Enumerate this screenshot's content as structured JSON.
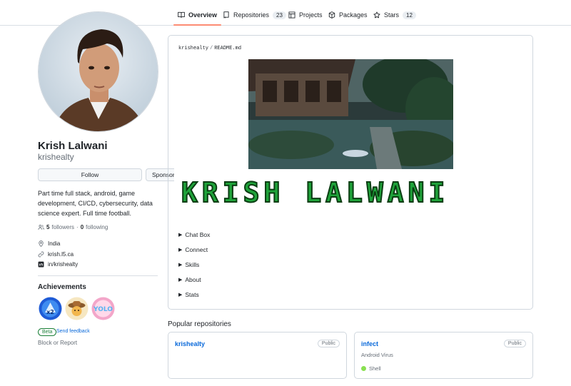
{
  "tabs": [
    {
      "label": "Overview",
      "icon": "book-icon",
      "active": true
    },
    {
      "label": "Repositories",
      "icon": "repo-icon",
      "count": "23"
    },
    {
      "label": "Projects",
      "icon": "table-icon"
    },
    {
      "label": "Packages",
      "icon": "package-icon"
    },
    {
      "label": "Stars",
      "icon": "star-icon",
      "count": "12"
    }
  ],
  "profile": {
    "name": "Krish Lalwani",
    "login": "krishealty",
    "follow_label": "Follow",
    "sponsor_label": "Sponsor",
    "bio": "Part time full stack, android, game development, CI/CD, cybersecurity, data science expert. Full time football.",
    "followers_count": "5",
    "followers_label": "followers",
    "following_count": "0",
    "following_label": "following",
    "location": "India",
    "website": "krish.l5.ca",
    "linkedin": "in/krishealty"
  },
  "achievements": {
    "title": "Achievements",
    "beta_label": "Beta",
    "feedback_label": "Send feedback",
    "block_label": "Block or Report"
  },
  "readme": {
    "owner": "krishealty",
    "separator": "/",
    "file": "README.md",
    "big_name": "KRISH LALWANI",
    "sections": [
      "Chat Box",
      "Connect",
      "Skills",
      "About",
      "Stats"
    ]
  },
  "popular": {
    "title": "Popular repositories",
    "repos": [
      {
        "name": "krishealty",
        "visibility": "Public",
        "description": "",
        "language": ""
      },
      {
        "name": "infect",
        "visibility": "Public",
        "description": "Android Virus",
        "language": "Shell",
        "language_color": "#89e051"
      }
    ]
  },
  "colors": {
    "accent_underline": "#fd8c73",
    "link": "#0969da",
    "beta_green": "#1a7f37"
  }
}
